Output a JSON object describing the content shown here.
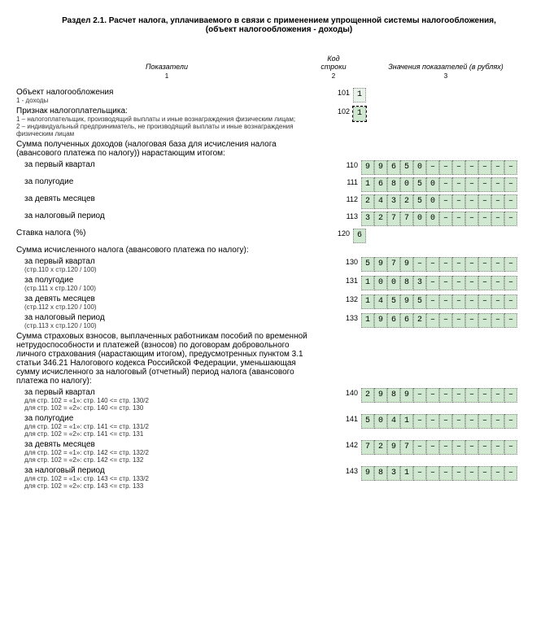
{
  "title": "Раздел 2.1. Расчет налога, уплачиваемого в связи с применением упрощенной системы налогообложения, (объект налогообложения - доходы)",
  "headers": {
    "col1": "Показатели",
    "col2": "Код строки",
    "col3": "Значения показателей (в рублях)",
    "sub1": "1",
    "sub2": "2",
    "sub3": "3"
  },
  "lines": {
    "obj": {
      "label": "Объект налогообложения",
      "sub": "1 - доходы",
      "code": "101",
      "value": "1"
    },
    "priznak": {
      "label": "Признак налогоплательщика:",
      "sub1": "1 – налогоплательщик, производящий выплаты и иные вознаграждения физическим лицам;",
      "sub2": "2 – индивидуальный предприниматель, не производящий выплаты и иные вознаграждения физическим лицам",
      "code": "102",
      "value": "1"
    },
    "incomeHead": "Сумма полученных доходов (налоговая база для исчисления налога (авансового платежа по налогу)) нарастающим итогом:",
    "q1": {
      "label": "за первый квартал",
      "code": "110",
      "value": "99650"
    },
    "half": {
      "label": "за полугодие",
      "code": "111",
      "value": "168050"
    },
    "nine": {
      "label": "за девять месяцев",
      "code": "112",
      "value": "243250"
    },
    "year": {
      "label": "за налоговый период",
      "code": "113",
      "value": "327700"
    },
    "rate": {
      "label": "Ставка налога (%)",
      "code": "120",
      "value": "6",
      "width": 1
    },
    "calcHead": "Сумма исчисленного налога (авансового платежа по налогу):",
    "c1": {
      "label": "за первый квартал",
      "sub": "(стр.110 x стр.120 / 100)",
      "code": "130",
      "value": "5979"
    },
    "c2": {
      "label": "за полугодие",
      "sub": "(стр.111 x стр.120 / 100)",
      "code": "131",
      "value": "10083"
    },
    "c3": {
      "label": "за девять месяцев",
      "sub": "(стр.112 x стр.120 / 100)",
      "code": "132",
      "value": "14595"
    },
    "c4": {
      "label": "за налоговый период",
      "sub": "(стр.113 x стр.120 / 100)",
      "code": "133",
      "value": "19662"
    },
    "insHead": "Сумма страховых взносов, выплаченных работникам пособий по временной нетрудоспособности и платежей (взносов) по договорам добровольного личного страхования (нарастающим итогом), предусмотренных пунктом 3.1 статьи 346.21 Налогового кодекса Российской Федерации, уменьшающая сумму исчисленного за налоговый (отчетный) период налога (авансового платежа по налогу):",
    "i1": {
      "label": "за первый квартал",
      "sub": "для стр. 102 = «1»: стр. 140 <= стр. 130/2\nдля стр. 102 = «2»: стр. 140 <= стр. 130",
      "code": "140",
      "value": "2989"
    },
    "i2": {
      "label": "за полугодие",
      "sub": "для стр. 102 = «1»: стр. 141 <= стр. 131/2\nдля стр. 102 = «2»: стр. 141 <= стр. 131",
      "code": "141",
      "value": "5041"
    },
    "i3": {
      "label": "за девять месяцев",
      "sub": "для стр. 102 = «1»: стр. 142 <= стр. 132/2\nдля стр. 102 = «2»: стр. 142 <= стр. 132",
      "code": "142",
      "value": "7297"
    },
    "i4": {
      "label": "за налоговый период",
      "sub": "для стр. 102 = «1»: стр. 143 <= стр. 133/2\nдля стр. 102 = «2»: стр. 143 <= стр. 133",
      "code": "143",
      "value": "9831"
    }
  },
  "cellWidth": 12
}
